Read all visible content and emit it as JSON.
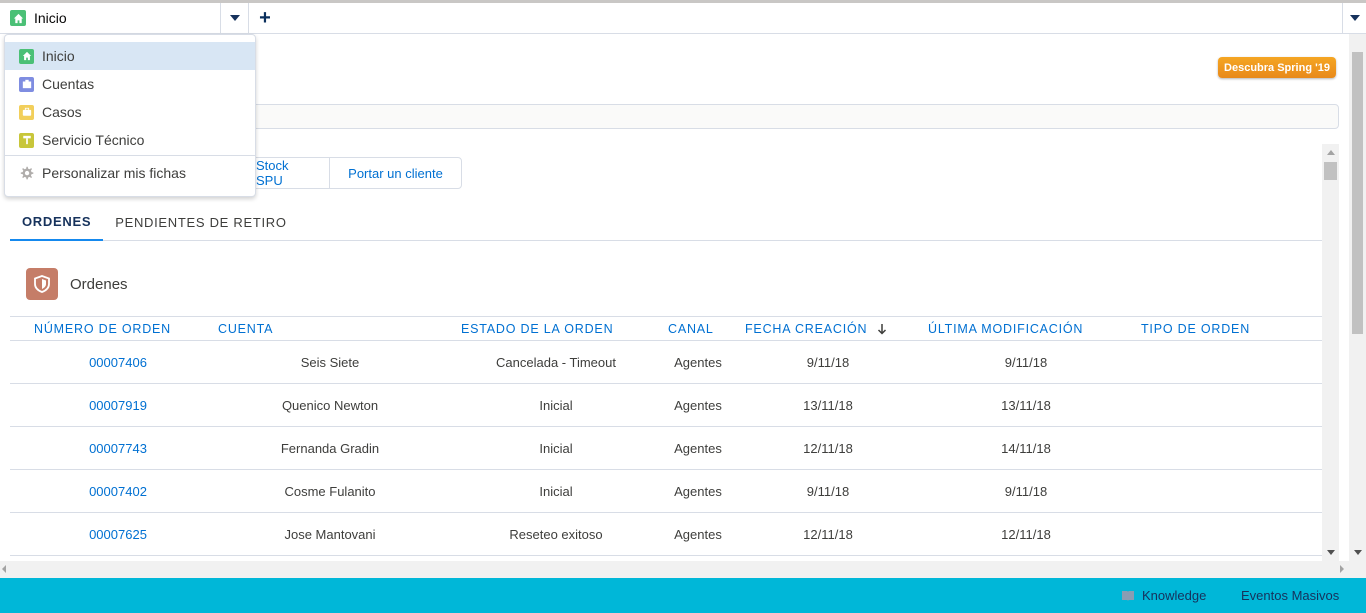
{
  "tabbar": {
    "active_tab": "Inicio",
    "icon": "home-icon",
    "add_label": "+"
  },
  "dropdown": {
    "items": [
      {
        "label": "Inicio",
        "icon": "home-icon",
        "color": "#4bc076"
      },
      {
        "label": "Cuentas",
        "icon": "account-icon",
        "color": "#7f8de1"
      },
      {
        "label": "Casos",
        "icon": "case-icon",
        "color": "#f2cf5b"
      },
      {
        "label": "Servicio Técnico",
        "icon": "service-icon",
        "color": "#c8c63a"
      }
    ],
    "customize_label": "Personalizar mis fichas",
    "customize_icon": "gear-icon"
  },
  "header": {
    "spring_button": "Descubra Spring '19"
  },
  "actions": {
    "stock_button": "Stock SPU",
    "port_button": "Portar un cliente"
  },
  "tabs": [
    "ORDENES",
    "PENDIENTES DE RETIRO"
  ],
  "card": {
    "title": "Ordenes",
    "icon": "shield-icon",
    "icon_color": "#c57d68"
  },
  "table": {
    "columns": [
      "NÚMERO DE ORDEN",
      "CUENTA",
      "ESTADO DE LA ORDEN",
      "CANAL",
      "FECHA CREACIÓN",
      "ÚLTIMA MODIFICACIÓN",
      "TIPO DE ORDEN"
    ],
    "sort_icon": "arrow-down-icon",
    "rows": [
      [
        "00007406",
        "Seis Siete",
        "Cancelada - Timeout",
        "Agentes",
        "9/11/18",
        "9/11/18",
        ""
      ],
      [
        "00007919",
        "Quenico Newton",
        "Inicial",
        "Agentes",
        "13/11/18",
        "13/11/18",
        ""
      ],
      [
        "00007743",
        "Fernanda Gradin",
        "Inicial",
        "Agentes",
        "12/11/18",
        "14/11/18",
        ""
      ],
      [
        "00007402",
        "Cosme Fulanito",
        "Inicial",
        "Agentes",
        "9/11/18",
        "9/11/18",
        ""
      ],
      [
        "00007625",
        "Jose Mantovani",
        "Reseteo exitoso",
        "Agentes",
        "12/11/18",
        "12/11/18",
        ""
      ]
    ]
  },
  "footer": {
    "knowledge": "Knowledge",
    "knowledge_icon": "book-icon",
    "events": "Eventos Masivos",
    "color": "#00b7d8"
  }
}
